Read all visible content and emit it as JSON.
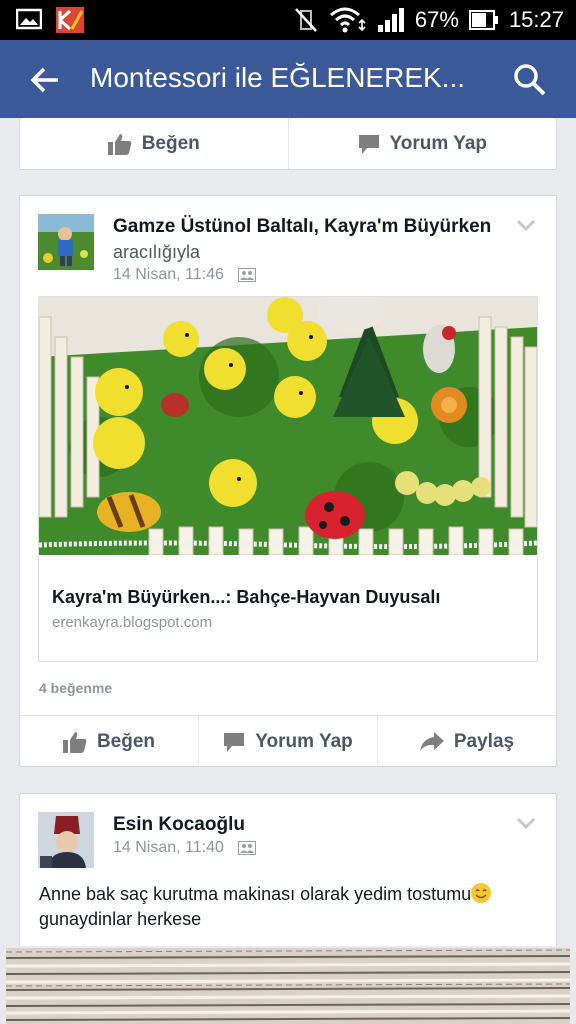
{
  "status_bar": {
    "battery": "67%",
    "time": "15:27"
  },
  "app_bar": {
    "title": "Montessori ile EĞLENEREK..."
  },
  "prev_post": {
    "actions": [
      "Beğen",
      "Yorum Yap"
    ]
  },
  "post1": {
    "author": "Gamze Üstünol Baltalı, Kayra'm Büyürken",
    "via": "aracılığıyla",
    "timestamp": "14 Nisan, 11:46",
    "link": {
      "title": "Kayra'm Büyürken...: Bahçe-Hayvan Duyusalı",
      "domain": "erenkayra.blogspot.com"
    },
    "likes": "4 beğenme",
    "actions": [
      "Beğen",
      "Yorum Yap",
      "Paylaş"
    ]
  },
  "post2": {
    "author": "Esin Kocaoğlu",
    "timestamp": "14 Nisan, 11:40",
    "text_before_emoji": "Anne bak saç kurutma makinası olarak yedim tostumu",
    "text_after_emoji": "gunaydinlar herkese"
  },
  "colors": {
    "brand": "#3b5998",
    "background": "#e9eaed"
  }
}
